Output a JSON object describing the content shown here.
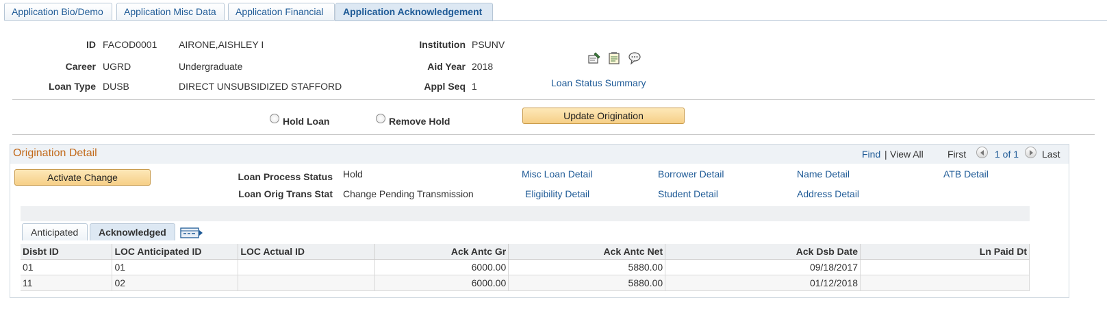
{
  "tabs": [
    {
      "label": "Application Bio/Demo"
    },
    {
      "label": "Application Misc Data"
    },
    {
      "label": "Application Financial"
    },
    {
      "label": "Application Acknowledgement"
    }
  ],
  "header": {
    "id_label": "ID",
    "id_value": "FACOD0001",
    "name": "AIRONE,AISHLEY I",
    "career_label": "Career",
    "career_value": "UGRD",
    "career_desc": "Undergraduate",
    "loan_type_label": "Loan Type",
    "loan_type_value": "DUSB",
    "loan_type_desc": "DIRECT UNSUBSIDIZED STAFFORD",
    "institution_label": "Institution",
    "institution_value": "PSUNV",
    "aid_year_label": "Aid Year",
    "aid_year_value": "2018",
    "appl_seq_label": "Appl Seq",
    "appl_seq_value": "1",
    "loan_status_link": "Loan Status Summary"
  },
  "actions": {
    "hold_loan": "Hold Loan",
    "remove_hold": "Remove Hold",
    "update_origination": "Update Origination"
  },
  "origination": {
    "title": "Origination Detail",
    "find": "Find",
    "separator": "|",
    "view_all": "View All",
    "first": "First",
    "count": "1 of 1",
    "last": "Last",
    "activate_change": "Activate Change",
    "process_status_label": "Loan Process Status",
    "process_status_value": "Hold",
    "orig_trans_label": "Loan Orig Trans Stat",
    "orig_trans_value": "Change Pending Transmission",
    "links": {
      "misc_loan_detail": "Misc Loan Detail",
      "borrower_detail": "Borrower Detail",
      "name_detail": "Name Detail",
      "atb_detail": "ATB Detail",
      "eligibility_detail": "Eligibility Detail",
      "student_detail": "Student Detail",
      "address_detail": "Address Detail"
    }
  },
  "subtabs": [
    {
      "label": "Anticipated"
    },
    {
      "label": "Acknowledged"
    }
  ],
  "grid": {
    "columns": [
      "Disbt ID",
      "LOC Anticipated ID",
      "LOC Actual ID",
      "Ack Antc Gr",
      "Ack Antc Net",
      "Ack Dsb Date",
      "Ln Paid Dt"
    ],
    "rows": [
      [
        "01",
        "01",
        "",
        "6000.00",
        "5880.00",
        "09/18/2017",
        ""
      ],
      [
        "11",
        "02",
        "",
        "6000.00",
        "5880.00",
        "01/12/2018",
        ""
      ]
    ]
  }
}
